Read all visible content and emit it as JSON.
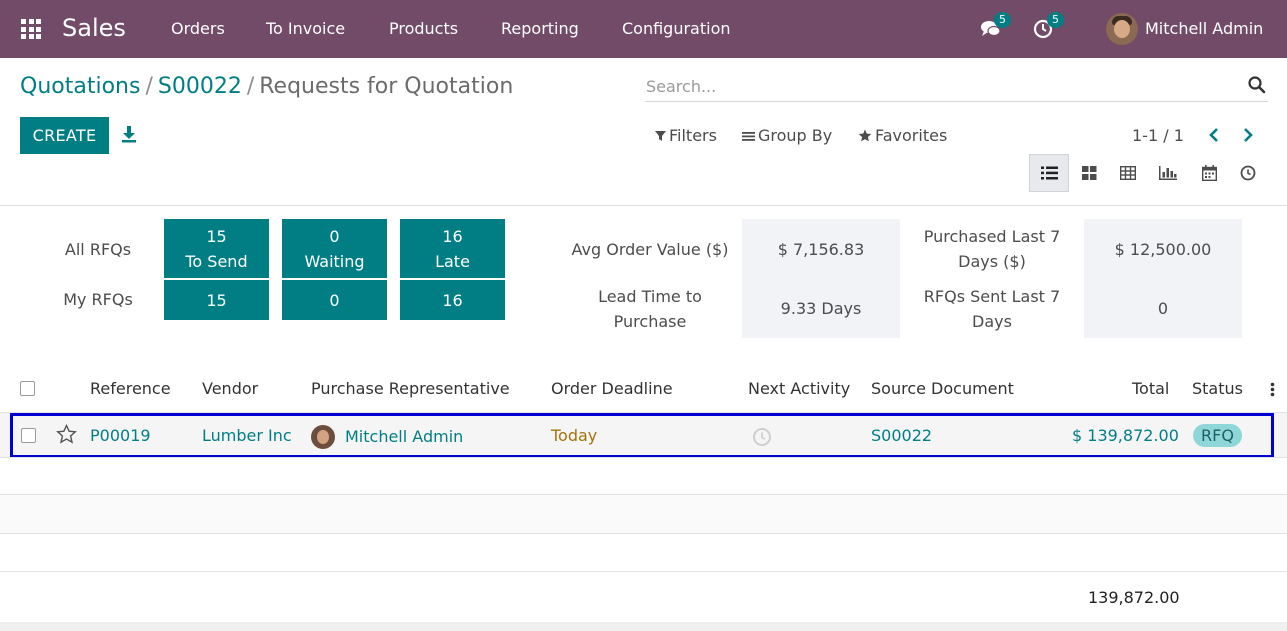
{
  "app": {
    "brand": "Sales",
    "menu": [
      "Orders",
      "To Invoice",
      "Products",
      "Reporting",
      "Configuration"
    ],
    "messages_count": "5",
    "activities_count": "5",
    "user_name": "Mitchell Admin"
  },
  "breadcrumb": {
    "items": [
      "Quotations",
      "S00022"
    ],
    "separator": "/",
    "current": "Requests for Quotation"
  },
  "search": {
    "placeholder": "Search..."
  },
  "toolbar": {
    "create_label": "CREATE",
    "filters_label": "Filters",
    "groupby_label": "Group By",
    "favorites_label": "Favorites",
    "pager": "1-1 / 1"
  },
  "views": [
    "list-view-icon",
    "kanban-view-icon",
    "pivot-view-icon",
    "graph-view-icon",
    "calendar-view-icon",
    "activity-view-icon"
  ],
  "dashboard": {
    "all_rfqs_label": "All RFQs",
    "my_rfqs_label": "My RFQs",
    "all_tiles": [
      {
        "count": "15",
        "label": "To Send"
      },
      {
        "count": "0",
        "label": "Waiting"
      },
      {
        "count": "16",
        "label": "Late"
      }
    ],
    "my_tiles": [
      "15",
      "0",
      "16"
    ],
    "kpis": {
      "avg_order_label": "Avg Order Value ($)",
      "avg_order_value": "$ 7,156.83",
      "lead_time_label": "Lead Time to Purchase",
      "lead_time_value": "9.33  Days",
      "purchased_label": "Purchased Last 7 Days ($)",
      "purchased_value": "$ 12,500.00",
      "rfqs_sent_label": "RFQs Sent Last 7 Days",
      "rfqs_sent_value": "0"
    }
  },
  "table": {
    "headers": [
      "Reference",
      "Vendor",
      "Purchase Representative",
      "Order Deadline",
      "Next Activity",
      "Source Document",
      "Total",
      "Status"
    ],
    "rows": [
      {
        "reference": "P00019",
        "vendor": "Lumber Inc",
        "representative": "Mitchell Admin",
        "deadline": "Today",
        "source": "S00022",
        "total": "$ 139,872.00",
        "status": "RFQ"
      }
    ],
    "footer_total": "139,872.00"
  },
  "colors": {
    "navbar": "#714b67",
    "primary": "#017e84",
    "highlight_border": "#0000d0",
    "deadline": "#a2740c"
  }
}
